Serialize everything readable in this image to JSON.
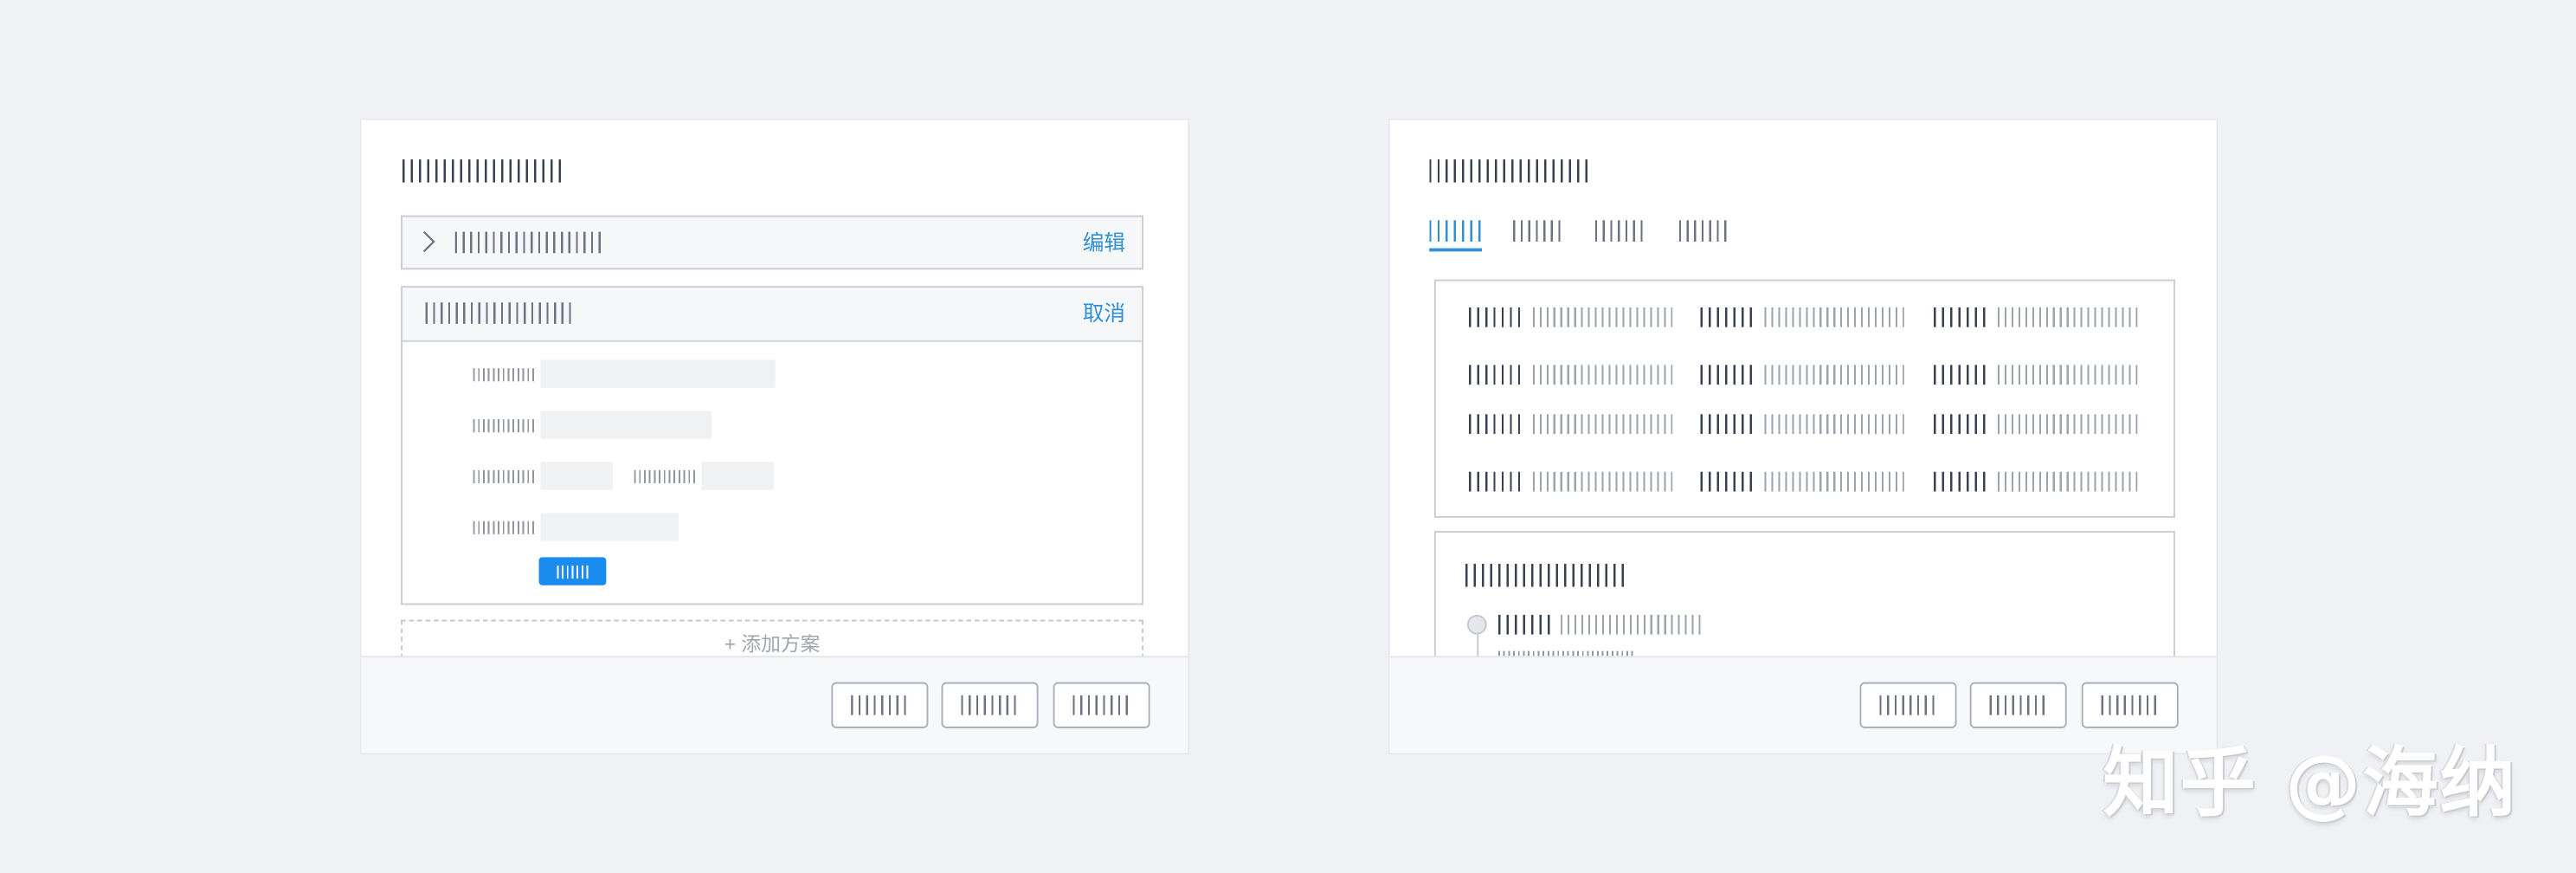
{
  "left_card": {
    "collapsed_panel": {
      "edit_label": "编辑"
    },
    "expanded_panel": {
      "cancel_label": "取消"
    },
    "add_plan_label": "+ 添加方案"
  },
  "right_card": {
    "tabs_count": 4,
    "active_tab_index": 0
  },
  "watermark": {
    "text": "知乎 @海纳"
  },
  "colors": {
    "accent": "#2f8fd8",
    "primary_button": "#1a8cf0",
    "page_background": "#f0f1f4"
  },
  "icons": {
    "collapsed_panel_arrow": "chevron-right-icon"
  }
}
